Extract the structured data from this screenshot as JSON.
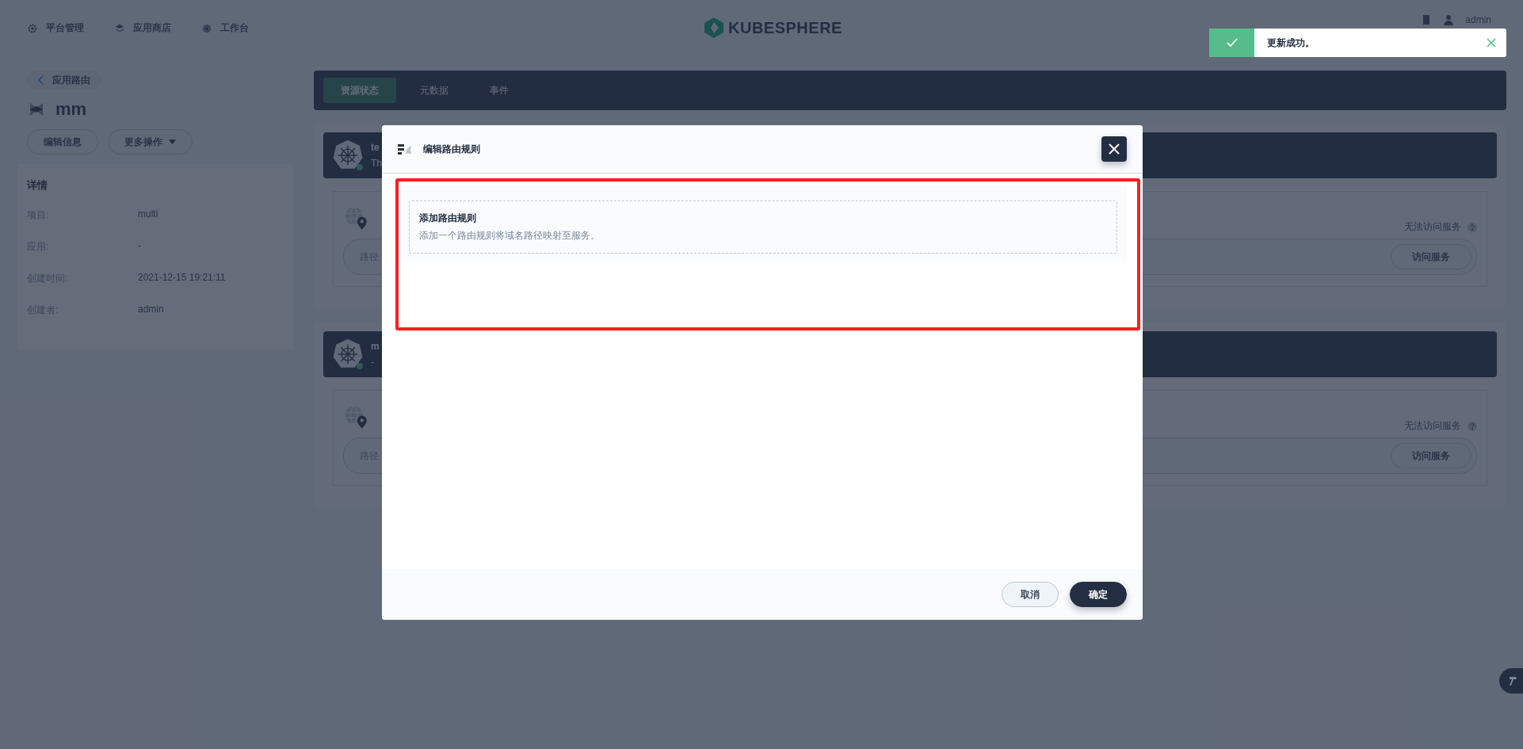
{
  "nav": {
    "items": [
      {
        "label": "平台管理",
        "kind": "gear"
      },
      {
        "label": "应用商店",
        "kind": "store"
      },
      {
        "label": "工作台",
        "kind": "desk"
      }
    ],
    "logo": "KUBESPHERE",
    "user": "admin"
  },
  "toast": {
    "message": "更新成功。"
  },
  "sidebar": {
    "back_link": "应用路由",
    "name": "mm",
    "actions": [
      {
        "label": "编辑信息",
        "kind": "plain"
      },
      {
        "label": "更多操作",
        "kind": "menu"
      }
    ],
    "details_title": "详情",
    "details": [
      {
        "label": "项目:",
        "value": "multi"
      },
      {
        "label": "应用:",
        "value": "-"
      },
      {
        "label": "创建时间:",
        "value": "2021-12-15 19:21:11"
      },
      {
        "label": "创建者:",
        "value": "admin"
      }
    ]
  },
  "tabs": [
    {
      "label": "资源状态",
      "selected": true
    },
    {
      "label": "元数据",
      "selected": false
    },
    {
      "label": "事件",
      "selected": false
    }
  ],
  "rules": [
    {
      "name": "te",
      "description": "Th",
      "status": "无法访问服务",
      "path_label": "路径",
      "action": "访问服务"
    },
    {
      "name": "m",
      "description": "-",
      "status": "无法访问服务",
      "path_label": "路径",
      "action": "访问服务"
    }
  ],
  "dialog": {
    "title": "编辑路由规则",
    "add_rule": {
      "title": "添加路由规则",
      "description": "添加一个路由规则将域名路径映射至服务。"
    },
    "buttons": [
      {
        "label": "取消",
        "kind": "secondary"
      },
      {
        "label": "确定",
        "kind": "primary"
      }
    ]
  }
}
